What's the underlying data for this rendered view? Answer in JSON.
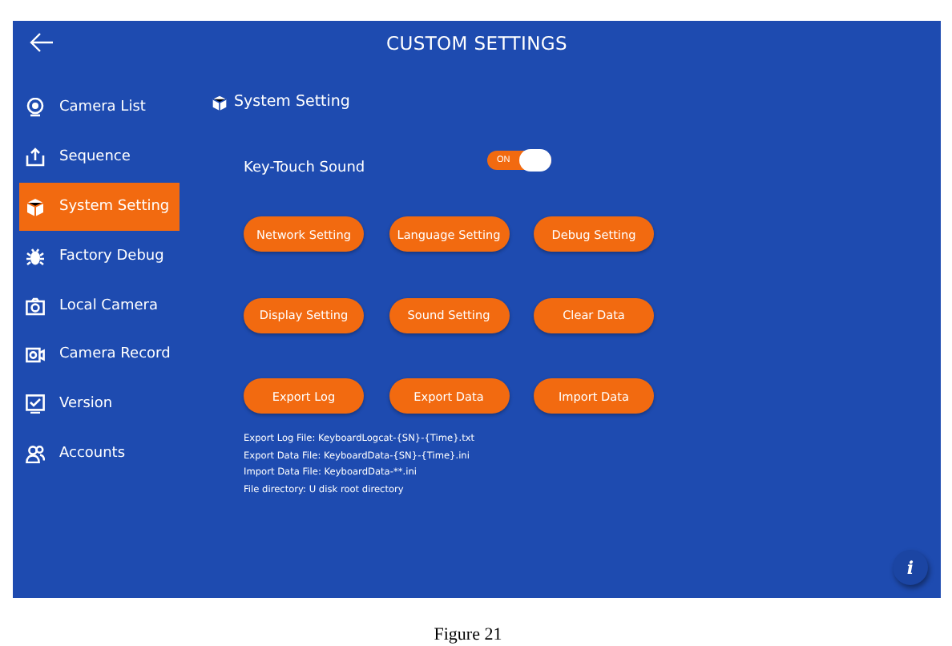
{
  "header": {
    "title": "CUSTOM SETTINGS"
  },
  "sidebar": {
    "items": [
      {
        "label": "Camera List",
        "selected": false
      },
      {
        "label": "Sequence",
        "selected": false
      },
      {
        "label": "System Setting",
        "selected": true
      },
      {
        "label": "Factory Debug",
        "selected": false
      },
      {
        "label": "Local Camera",
        "selected": false
      },
      {
        "label": "Camera Record",
        "selected": false
      },
      {
        "label": "Version",
        "selected": false
      },
      {
        "label": "Accounts",
        "selected": false
      }
    ]
  },
  "section": {
    "title": "System Setting"
  },
  "key_touch_sound": {
    "label": "Key-Touch Sound",
    "on": true,
    "state_text": "ON"
  },
  "buttons": [
    [
      "Network Setting",
      "Language Setting",
      "Debug Setting"
    ],
    [
      "Display Setting",
      "Sound Setting",
      "Clear Data"
    ],
    [
      "Export Log",
      "Export Data",
      "Import Data"
    ]
  ],
  "notes": [
    "Export Log File: KeyboardLogcat-{SN}-{Time}.txt",
    "Export Data File: KeyboardData-{SN}-{Time}.ini",
    "Import Data File: KeyboardData-**.ini",
    "File directory: U disk root directory"
  ],
  "info_button": "i",
  "caption": "Figure 21"
}
